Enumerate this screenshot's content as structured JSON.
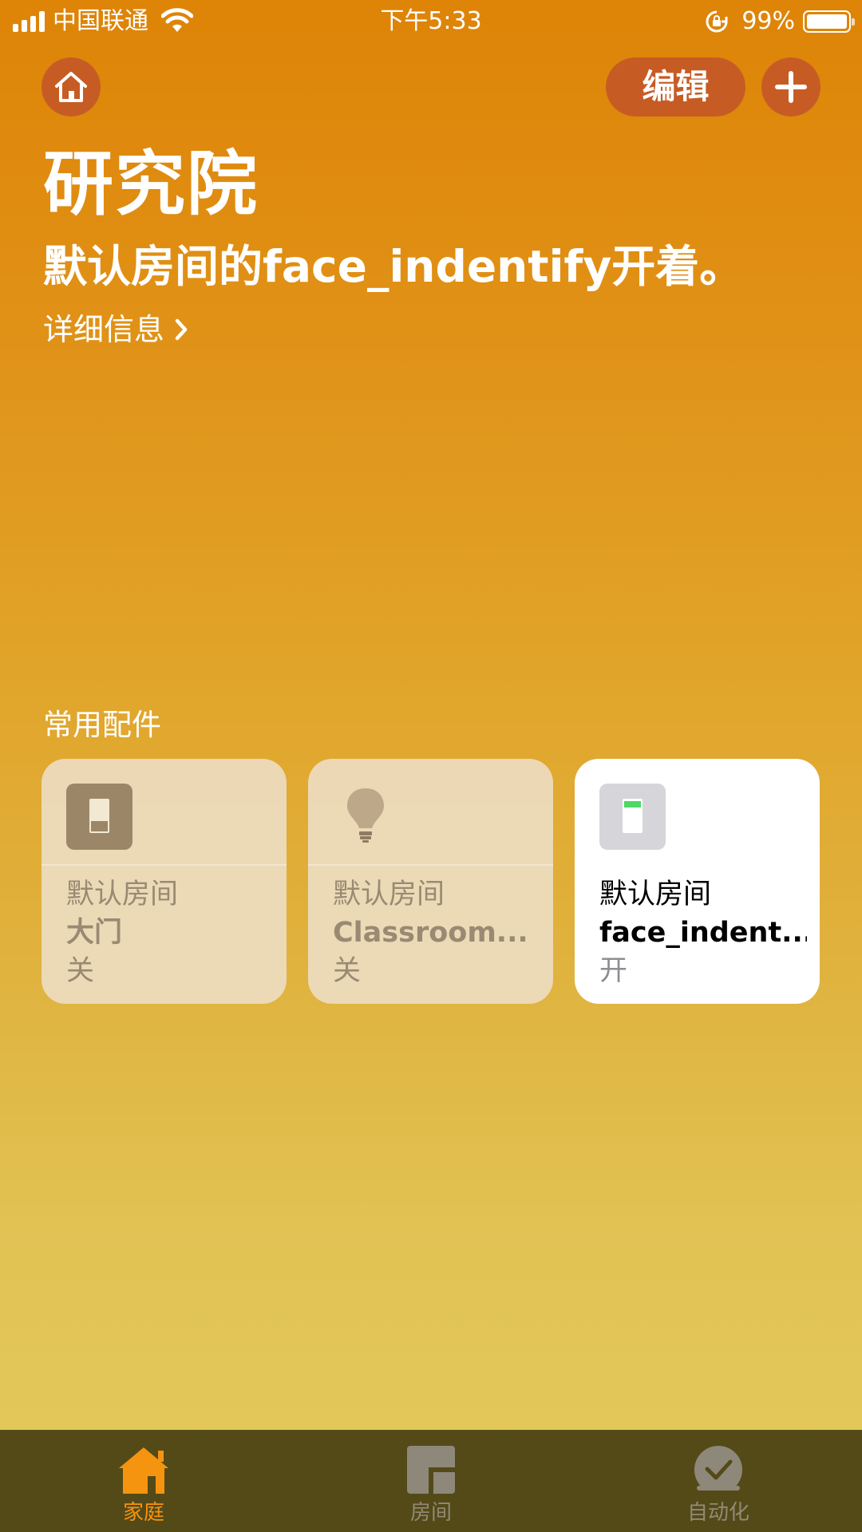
{
  "status_bar": {
    "carrier": "中国联通",
    "time": "下午5:33",
    "battery": "99%",
    "battery_level": 0.99
  },
  "header": {
    "edit_label": "编辑"
  },
  "home": {
    "title": "研究院",
    "status_text": "默认房间的face_indentify开着。",
    "details_link": "详细信息"
  },
  "favorites": {
    "section_title": "常用配件",
    "tiles": [
      {
        "room": "默认房间",
        "name": "大门",
        "state": "关",
        "icon": "switch-icon",
        "on": false
      },
      {
        "room": "默认房间",
        "name": "Classroom...",
        "state": "关",
        "icon": "lightbulb-icon",
        "on": false
      },
      {
        "room": "默认房间",
        "name": "face_indent...",
        "state": "开",
        "icon": "switch-icon",
        "on": true
      }
    ]
  },
  "tab_bar": {
    "tabs": [
      {
        "label": "家庭",
        "icon": "house-icon",
        "active": true
      },
      {
        "label": "房间",
        "icon": "rooms-icon",
        "active": false
      },
      {
        "label": "自动化",
        "icon": "automation-icon",
        "active": false
      }
    ]
  },
  "colors": {
    "accent": "#f5940f",
    "button_bg": "#c65c24",
    "tabbar_bg": "#544a18",
    "switch_on_green": "#4cd964"
  }
}
